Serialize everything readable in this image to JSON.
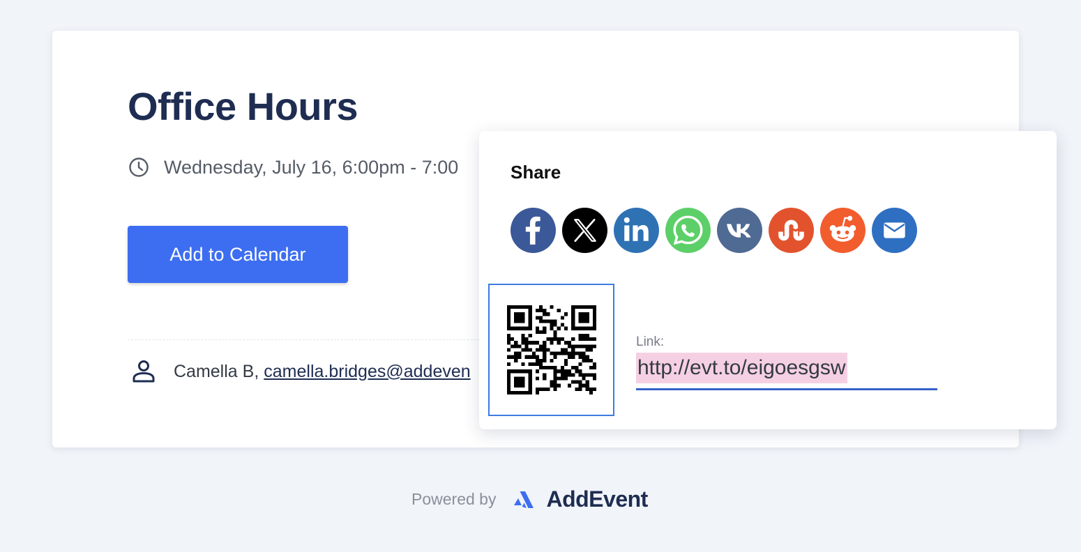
{
  "event": {
    "title": "Office Hours",
    "date_text": "Wednesday, July 16, 6:00pm - 7:00",
    "add_button_label": "Add to Calendar",
    "organizer_name": "Camella B,",
    "organizer_email": "camella.bridges@addeven"
  },
  "share": {
    "title": "Share",
    "social": [
      {
        "name": "facebook",
        "icon": "facebook-icon",
        "color": "#3b5998"
      },
      {
        "name": "x",
        "icon": "x-icon",
        "color": "#000000"
      },
      {
        "name": "linkedin",
        "icon": "linkedin-icon",
        "color": "#2f72b4"
      },
      {
        "name": "whatsapp",
        "icon": "whatsapp-icon",
        "color": "#5dcf68"
      },
      {
        "name": "vk",
        "icon": "vk-icon",
        "color": "#4f6a93"
      },
      {
        "name": "stumbleupon",
        "icon": "stumbleupon-icon",
        "color": "#e2532d"
      },
      {
        "name": "reddit",
        "icon": "reddit-icon",
        "color": "#f25d2e"
      },
      {
        "name": "email",
        "icon": "envelope-icon",
        "color": "#2f6fc1"
      }
    ],
    "qr_icon": "qr-code-icon",
    "link_label": "Link:",
    "link_value": "http://evt.to/eigoesgsw"
  },
  "footer": {
    "powered_by": "Powered by",
    "brand": "AddEvent"
  },
  "colors": {
    "accent": "#3d6ef1",
    "title": "#1e2d51",
    "background": "#f1f4f9",
    "link_highlight": "#f5d0e2"
  }
}
